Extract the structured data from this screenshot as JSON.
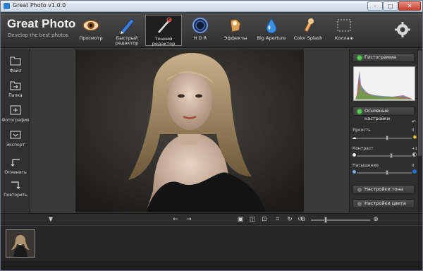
{
  "window": {
    "title": "Great Photo v1.0.0",
    "min": "–",
    "max": "□",
    "close": "✕"
  },
  "header": {
    "logo": "Great Photo",
    "tagline": "Develop the best photos",
    "tools": [
      {
        "label": "Просмотр",
        "icon": "eye-icon"
      },
      {
        "label": "Быстрый редактор",
        "icon": "pencil-icon"
      },
      {
        "label": "Тонкий редактор",
        "icon": "wand-icon",
        "active": true
      },
      {
        "label": "H D R",
        "icon": "hdr-ring-icon"
      },
      {
        "label": "Эффекты",
        "icon": "effects-icon"
      },
      {
        "label": "Big Aperture",
        "icon": "drop-icon"
      },
      {
        "label": "Color Splash",
        "icon": "splash-icon"
      },
      {
        "label": "Коллаж",
        "icon": "collage-icon"
      }
    ],
    "settings_icon": "gear-icon"
  },
  "sidebar": {
    "items": [
      {
        "label": "Файл",
        "icon": "folder-icon"
      },
      {
        "label": "Папка",
        "icon": "folder-arrow-icon"
      },
      {
        "label": "Фотография",
        "icon": "add-photo-icon"
      },
      {
        "label": "Экспорт",
        "icon": "export-icon"
      },
      {
        "label": "Отменить",
        "icon": "undo-icon"
      },
      {
        "label": "Повторить",
        "icon": "redo-icon"
      }
    ]
  },
  "right_panel": {
    "histogram_btn": "Гистограмма",
    "basic_btn": "Основные настройки",
    "sliders": [
      {
        "label": "Яркость",
        "value": "0",
        "position": 0.55
      },
      {
        "label": "Контраст",
        "value": "+17",
        "position": 0.63
      },
      {
        "label": "Насыщение",
        "value": "0",
        "position": 0.55
      }
    ],
    "tone_btn": "Настройки тона",
    "color_btn": "Настройки цвета"
  },
  "bottom": {
    "zoom_level": 0.25
  },
  "colors": {
    "accent_led": "#4cd14c",
    "bg": "#3a3a3a"
  }
}
